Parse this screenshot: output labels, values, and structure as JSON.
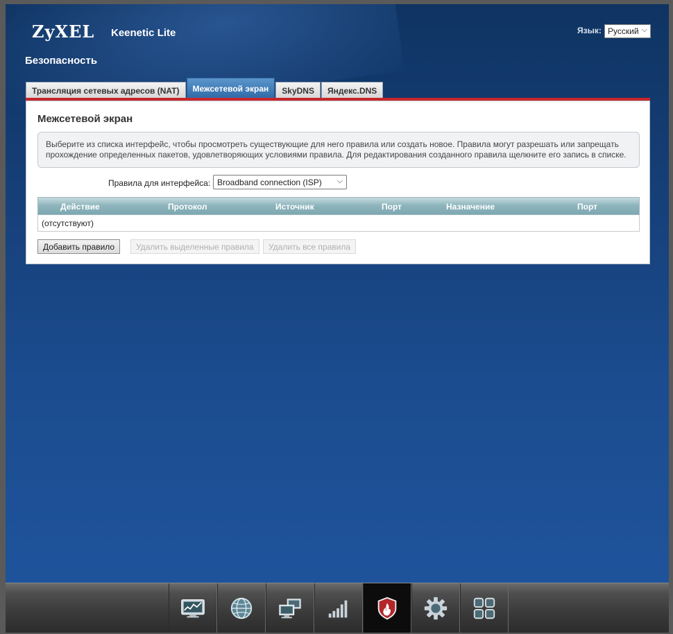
{
  "header": {
    "brand": "ZyXEL",
    "model": "Keenetic Lite",
    "language_label": "Язык:",
    "language_selected": "Русский"
  },
  "section_title": "Безопасность",
  "tabs": [
    {
      "label": "Трансляция сетевых адресов (NAT)",
      "active": false
    },
    {
      "label": "Межсетевой экран",
      "active": true
    },
    {
      "label": "SkyDNS",
      "active": false
    },
    {
      "label": "Яндекс.DNS",
      "active": false
    }
  ],
  "panel": {
    "title": "Межсетевой экран",
    "info_line1": "Выберите из списка интерфейс, чтобы просмотреть существующие для него правила или создать новое. Правила могут разрешать или запрещать",
    "info_line2": "прохождение определенных пакетов, удовлетворяющих условиями правила. Для редактирования созданного правила щелкните его запись в списке.",
    "interface_label": "Правила для интерфейса:",
    "interface_selected": "Broadband connection (ISP)",
    "columns": [
      "Действие",
      "Протокол",
      "Источник",
      "Порт",
      "Назначение",
      "Порт"
    ],
    "empty_text": "(отсутствуют)",
    "buttons": {
      "add": "Добавить правило",
      "delete_selected": "Удалить выделенные правила",
      "delete_all": "Удалить все правила"
    }
  },
  "dock": {
    "items": [
      {
        "icon": "monitor-chart-icon",
        "active": false
      },
      {
        "icon": "globe-icon",
        "active": false
      },
      {
        "icon": "network-computers-icon",
        "active": false
      },
      {
        "icon": "signal-bars-icon",
        "active": false
      },
      {
        "icon": "security-shield-icon",
        "active": true
      },
      {
        "icon": "gear-icon",
        "active": false
      },
      {
        "icon": "apps-grid-icon",
        "active": false
      }
    ]
  },
  "colors": {
    "accent_red": "#c8262a",
    "tab_active": "#2f6aa6",
    "table_header": "#8fb5bd"
  }
}
